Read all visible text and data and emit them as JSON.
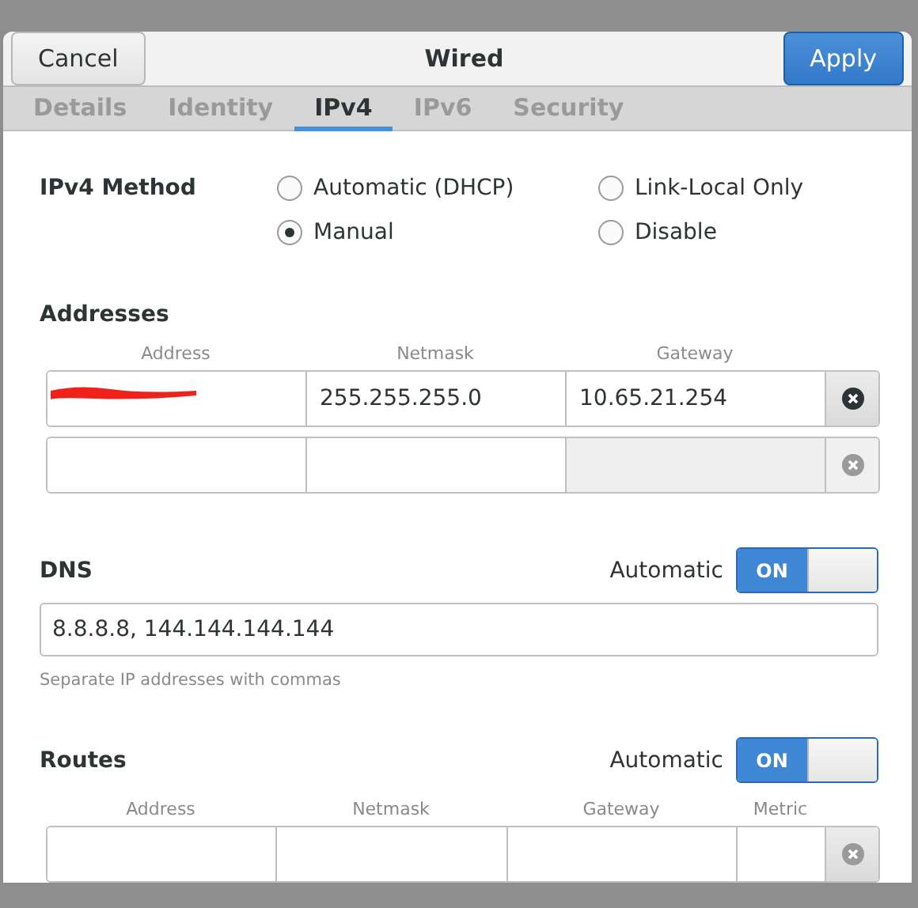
{
  "window": {
    "title": "Wired"
  },
  "header_buttons": [
    {
      "label": "Cancel",
      "kind": "plain"
    },
    {
      "label": "Apply",
      "kind": "primary"
    }
  ],
  "tabs": [
    {
      "label": "Details",
      "selected": false
    },
    {
      "label": "Identity",
      "selected": false
    },
    {
      "label": "IPv4",
      "selected": true
    },
    {
      "label": "IPv6",
      "selected": false
    },
    {
      "label": "Security",
      "selected": false
    }
  ],
  "ipv4_method": {
    "label": "IPv4 Method",
    "options": [
      {
        "label": "Automatic (DHCP)",
        "selected": false
      },
      {
        "label": "Link-Local Only",
        "selected": false
      },
      {
        "label": "Manual",
        "selected": true
      },
      {
        "label": "Disable",
        "selected": false
      }
    ]
  },
  "addresses": {
    "title": "Addresses",
    "columns": [
      "Address",
      "Netmask",
      "Gateway"
    ],
    "rows": [
      {
        "cells": [
          {},
          {
            "value": "255.255.255.0"
          },
          {
            "value": "10.65.21.254"
          }
        ],
        "redacted": true,
        "removable": true
      },
      {
        "cells": [
          {},
          {},
          {}
        ],
        "removable": false
      }
    ]
  },
  "dns": {
    "title": "DNS",
    "automatic_label": "Automatic",
    "toggle": {
      "label": "ON",
      "on": true
    },
    "value": "8.8.8.8, 144.144.144.144",
    "hint": "Separate IP addresses with commas"
  },
  "routes": {
    "title": "Routes",
    "automatic_label": "Automatic",
    "toggle": {
      "label": "ON",
      "on": true
    },
    "columns": [
      "Address",
      "Netmask",
      "Gateway",
      "Metric"
    ]
  }
}
